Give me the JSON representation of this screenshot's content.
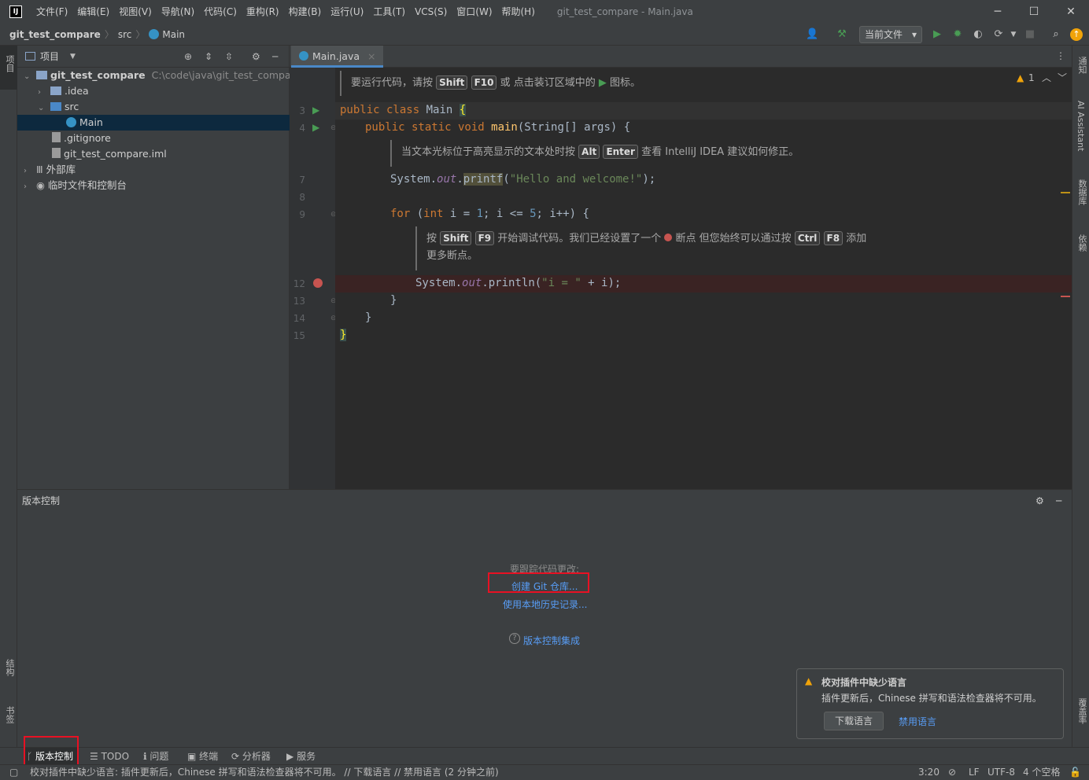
{
  "app": {
    "logo": "IJ",
    "window_title": "git_test_compare - Main.java"
  },
  "menu": [
    "文件(F)",
    "编辑(E)",
    "视图(V)",
    "导航(N)",
    "代码(C)",
    "重构(R)",
    "构建(B)",
    "运行(U)",
    "工具(T)",
    "VCS(S)",
    "窗口(W)",
    "帮助(H)"
  ],
  "window_controls": {
    "minimize": "─",
    "maximize": "☐",
    "close": "✕"
  },
  "breadcrumb": {
    "project": "git_test_compare",
    "folder": "src",
    "file": "Main"
  },
  "toolbar": {
    "run_config": "当前文件",
    "run_config_arrow": "▾"
  },
  "left_strip": {
    "project": "项目",
    "structure": "结构",
    "bookmarks": "书签"
  },
  "right_strip": {
    "notifications": "通知",
    "ai": "AI Assistant",
    "database": "数据库",
    "gradle": "依赖",
    "coverage": "覆盖率"
  },
  "project_panel": {
    "title": "项目",
    "tree": [
      {
        "label": "git_test_compare",
        "path": "C:\\code\\java\\git_test_compare"
      },
      {
        "label": ".idea"
      },
      {
        "label": "src"
      },
      {
        "label": "Main"
      },
      {
        "label": ".gitignore"
      },
      {
        "label": "git_test_compare.iml"
      },
      {
        "label": "外部库"
      },
      {
        "label": "临时文件和控制台"
      }
    ]
  },
  "editor": {
    "tab": "Main.java",
    "tab_close": "×",
    "warning_count": "1",
    "hint1": {
      "pre": "要运行代码，请按",
      "k1": "Shift",
      "k2": "F10",
      "post": "或 点击装订区域中的",
      "tail": "图标。"
    },
    "hint2": {
      "pre": "当文本光标位于高亮显示的文本处时按",
      "k1": "Alt",
      "k2": "Enter",
      "post": "查看 IntelliJ IDEA 建议如何修正。"
    },
    "hint3": {
      "pre": "按",
      "k1": "Shift",
      "k2": "F9",
      "mid": "开始调试代码。我们已经设置了一个",
      "mid2": "断点 但您始终可以通过按",
      "k3": "Ctrl",
      "k4": "F8",
      "post": "添加",
      "line2": "更多断点。"
    },
    "line_numbers": [
      "3",
      "4",
      "7",
      "8",
      "9",
      "12",
      "13",
      "14",
      "15"
    ],
    "code": {
      "l3_kw": "public class",
      "l3_name": " Main ",
      "l3_brace": "{",
      "l4_kw": "public static void",
      "l4_fn": " main",
      "l4_rest": "(String[] args) {",
      "l7_a": "System.",
      "l7_out": "out",
      "l7_dot": ".",
      "l7_fn": "printf",
      "l7_p": "(",
      "l7_str": "\"Hello and welcome!\"",
      "l7_end": ");",
      "l9_for": "for",
      "l9_a": " (",
      "l9_int": "int",
      "l9_b": " i = ",
      "l9_1": "1",
      "l9_c": "; i <= ",
      "l9_5": "5",
      "l9_d": "; i++) {",
      "l12_a": "System.",
      "l12_out": "out",
      "l12_b": ".println(",
      "l12_str": "\"i = \"",
      "l12_c": " + i);",
      "l13": "}",
      "l14": "}",
      "l15": "}"
    }
  },
  "vcs_panel": {
    "title": "版本控制",
    "prompt": "要跟踪代码更改:",
    "create_git": "创建 Git 仓库...",
    "local_history": "使用本地历史记录...",
    "help_link": "版本控制集成"
  },
  "notification": {
    "title": "校对插件中缺少语言",
    "body": "插件更新后，Chinese 拼写和语法检查器将不可用。",
    "download_btn": "下载语言",
    "disable_link": "禁用语言"
  },
  "tool_tabs": [
    "版本控制",
    "TODO",
    "问题",
    "终端",
    "分析器",
    "服务"
  ],
  "status": {
    "message": "校对插件中缺少语言: 插件更新后，Chinese 拼写和语法检查器将不可用。 // 下载语言 // 禁用语言 (2 分钟之前)",
    "position": "3:20",
    "line_sep": "LF",
    "encoding": "UTF-8",
    "indent": "4 个空格"
  },
  "colors": {
    "accent": "#4a88c7",
    "link": "#589df6",
    "highlight_box": "#e81123",
    "breakpoint": "#c75450",
    "run_green": "#499c54"
  }
}
